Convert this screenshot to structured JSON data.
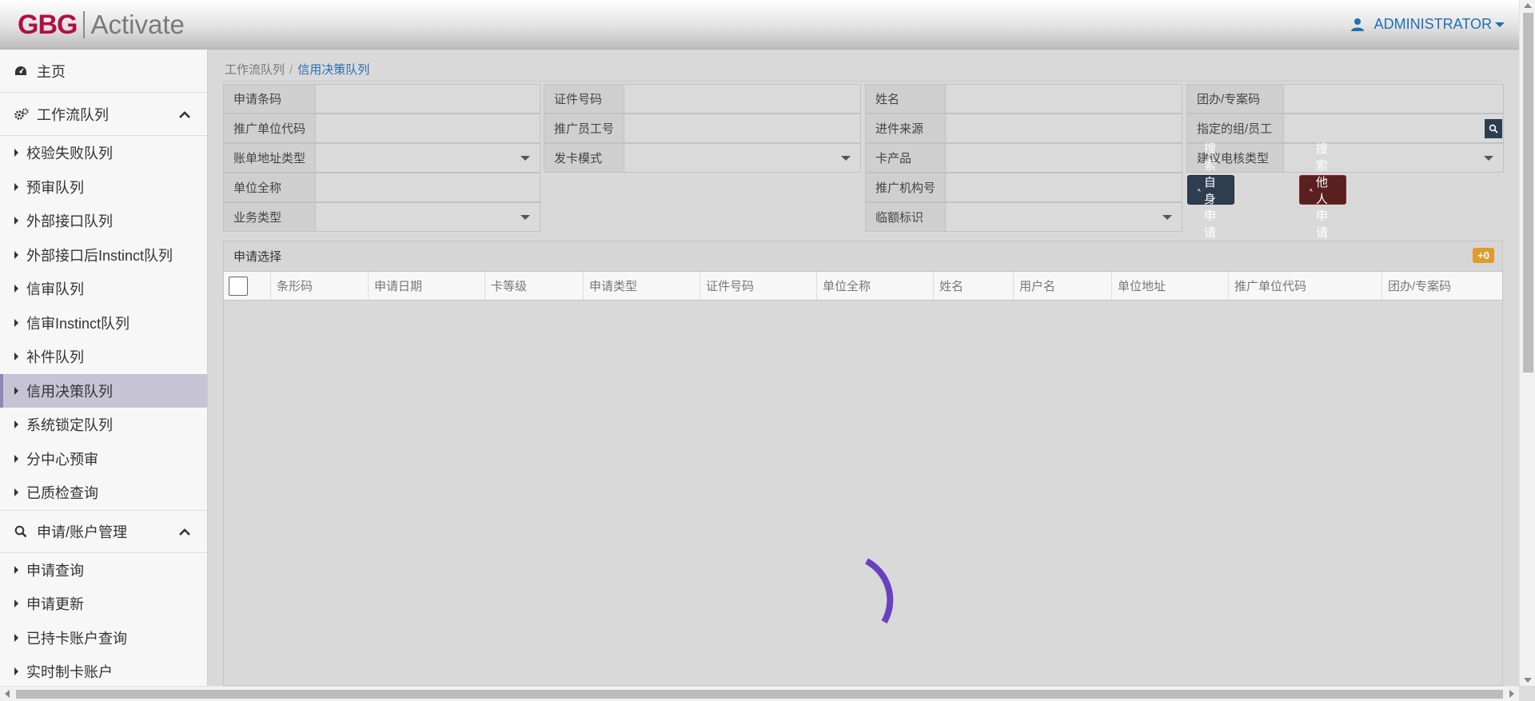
{
  "header": {
    "logo_primary": "GBG",
    "logo_secondary": "Activate",
    "user_name": "ADMINISTRATOR"
  },
  "sidebar": {
    "home": "主页",
    "sections": [
      {
        "title": "工作流队列",
        "items": [
          "校验失败队列",
          "预审队列",
          "外部接口队列",
          "外部接口后Instinct队列",
          "信审队列",
          "信审Instinct队列",
          "补件队列",
          "信用决策队列",
          "系统锁定队列",
          "分中心预审",
          "已质检查询"
        ],
        "active_index": 7
      },
      {
        "title": "申请/账户管理",
        "items": [
          "申请查询",
          "申请更新",
          "已持卡账户查询",
          "实时制卡账户"
        ]
      }
    ]
  },
  "breadcrumb": {
    "parent": "工作流队列",
    "separator": "/",
    "current": "信用决策队列"
  },
  "form": {
    "col1": [
      "申请条码",
      "推广单位代码",
      "账单地址类型",
      "单位全称",
      "业务类型"
    ],
    "col2": [
      "证件号码",
      "推广员工号",
      "发卡模式"
    ],
    "col3": [
      "姓名",
      "进件来源",
      "卡产品",
      "推广机构号",
      "临额标识"
    ],
    "col4": [
      "团办/专案码",
      "指定的组/员工",
      "建议电核类型"
    ]
  },
  "buttons": {
    "search_self": "搜索自身申请",
    "search_others": "搜索他人申请"
  },
  "panel": {
    "title": "申请选择",
    "badge": "+0",
    "columns": [
      "条形码",
      "申请日期",
      "卡等级",
      "申请类型",
      "证件号码",
      "单位全称",
      "姓名",
      "用户名",
      "单位地址",
      "推广单位代码",
      "团办/专案码"
    ]
  },
  "colors": {
    "brand": "#b01040",
    "link": "#1f6fb5",
    "active_item": "#c6c4d4",
    "btn_dark": "#2c3e50",
    "btn_red": "#5a2020",
    "badge": "#e09b2f",
    "spinner": "#6a3fc0"
  },
  "icons": [
    "user-icon",
    "dashboard-icon",
    "gears-icon",
    "chevron-up-icon",
    "search-icon",
    "caret-right-icon",
    "caret-down-icon",
    "spinner-icon"
  ]
}
